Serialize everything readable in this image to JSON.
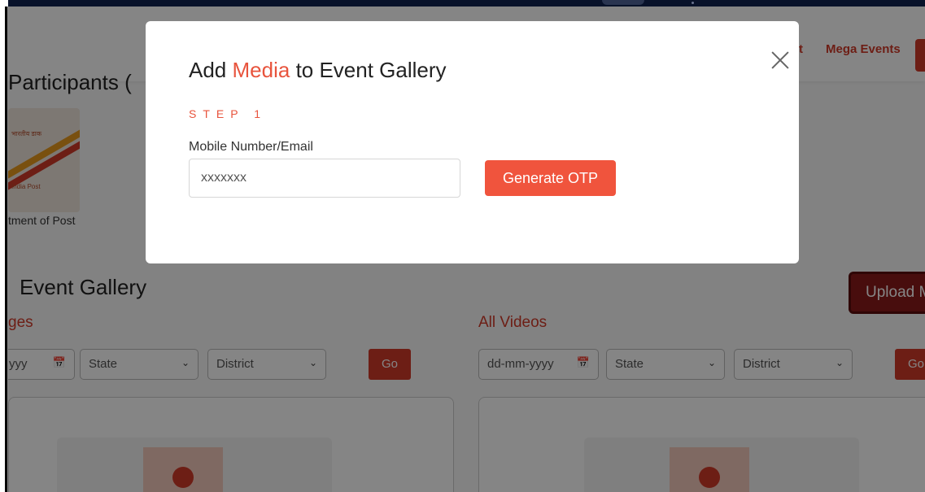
{
  "header": {
    "nav_partial": "t",
    "nav_mega_events": "Mega Events"
  },
  "participants": {
    "title_partial": "Participants (",
    "logo_text_top": "भारतीय डाक",
    "logo_text_bottom": "India Post",
    "caption_partial": "tment of Post"
  },
  "gallery": {
    "title_partial": "Event Gallery",
    "upload_button_partial": "Upload M",
    "images": {
      "heading_partial": "ges",
      "date_partial": "yyy",
      "state": "State",
      "district": "District",
      "go": "Go"
    },
    "videos": {
      "heading": "All Videos",
      "date": "dd-mm-yyyy",
      "state": "State",
      "district": "District",
      "go_partial": "Go"
    }
  },
  "modal": {
    "title_prefix": "Add",
    "title_accent": "Media",
    "title_suffix": "to Event Gallery",
    "step": "STEP 1",
    "field_label": "Mobile Number/Email",
    "input_placeholder": "xxxxxxx",
    "generate_button": "Generate OTP"
  },
  "colors": {
    "accent": "#e8543d",
    "brand_red": "#d23a2a",
    "top_bar": "#0d1b3a"
  }
}
